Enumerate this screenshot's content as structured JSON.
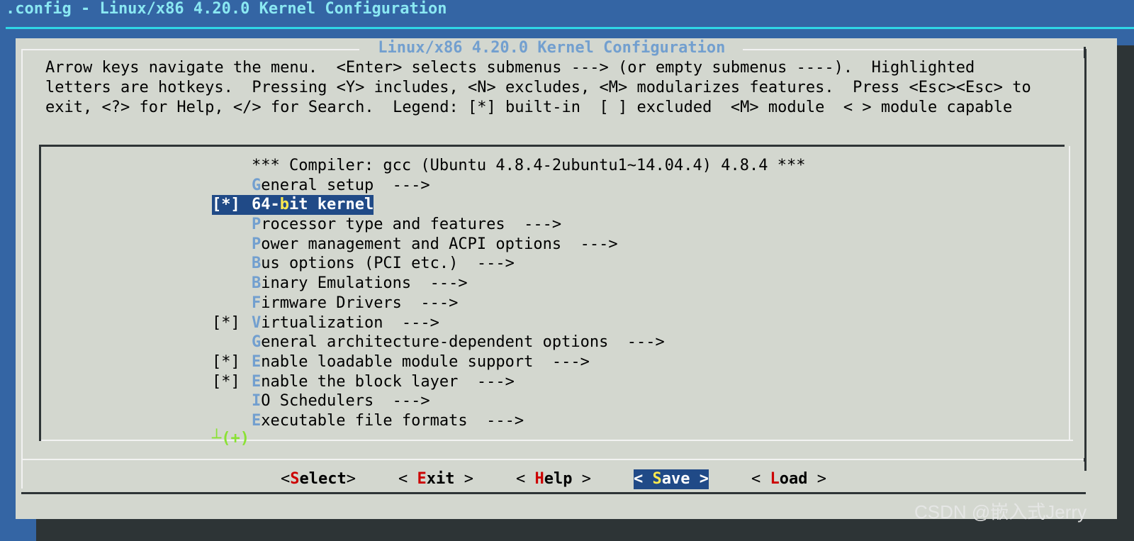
{
  "window": {
    "title": ".config - Linux/x86 4.20.0 Kernel Configuration"
  },
  "dialog": {
    "title": "Linux/x86 4.20.0 Kernel Configuration",
    "help_text": "Arrow keys navigate the menu.  <Enter> selects submenus ---> (or empty submenus ----).  Highlighted\nletters are hotkeys.  Pressing <Y> includes, <N> excludes, <M> modularizes features.  Press <Esc><Esc> to\nexit, <?> for Help, </> for Search.  Legend: [*] built-in  [ ] excluded  <M> module  < > module capable"
  },
  "menu": {
    "items": [
      {
        "prefix": "   ",
        "hot_before": "",
        "hot": "",
        "text": "*** Compiler: gcc (Ubuntu 4.8.4-2ubuntu1~14.04.4) 4.8.4 ***",
        "selected": false
      },
      {
        "prefix": "   ",
        "hot_before": "",
        "hot": "G",
        "text": "eneral setup  --->",
        "selected": false
      },
      {
        "prefix": "[*]",
        "hot_before": "64-",
        "hot": "b",
        "text": "it kernel",
        "selected": true
      },
      {
        "prefix": "   ",
        "hot_before": "",
        "hot": "P",
        "text": "rocessor type and features  --->",
        "selected": false
      },
      {
        "prefix": "   ",
        "hot_before": "",
        "hot": "P",
        "text": "ower management and ACPI options  --->",
        "selected": false
      },
      {
        "prefix": "   ",
        "hot_before": "",
        "hot": "B",
        "text": "us options (PCI etc.)  --->",
        "selected": false
      },
      {
        "prefix": "   ",
        "hot_before": "",
        "hot": "B",
        "text": "inary Emulations  --->",
        "selected": false
      },
      {
        "prefix": "   ",
        "hot_before": "",
        "hot": "F",
        "text": "irmware Drivers  --->",
        "selected": false
      },
      {
        "prefix": "[*]",
        "hot_before": "",
        "hot": "V",
        "text": "irtualization  --->",
        "selected": false
      },
      {
        "prefix": "   ",
        "hot_before": "",
        "hot": "G",
        "text": "eneral architecture-dependent options  --->",
        "selected": false
      },
      {
        "prefix": "[*]",
        "hot_before": "",
        "hot": "E",
        "text": "nable loadable module support  --->",
        "selected": false
      },
      {
        "prefix": "[*]",
        "hot_before": "",
        "hot": "E",
        "text": "nable the block layer  --->",
        "selected": false
      },
      {
        "prefix": "   ",
        "hot_before": "",
        "hot": "I",
        "text": "O Schedulers  --->",
        "selected": false
      },
      {
        "prefix": "   ",
        "hot_before": "",
        "hot": "E",
        "text": "xecutable file formats  --->",
        "selected": false
      }
    ],
    "more_indicator": "┴(+)"
  },
  "buttons": {
    "select": {
      "open": "<",
      "hot": "S",
      "rest": "elect",
      "close": ">"
    },
    "exit": {
      "open": "< ",
      "hot": "E",
      "rest": "xit",
      "close": " >"
    },
    "help": {
      "open": "< ",
      "hot": "H",
      "rest": "elp",
      "close": " >"
    },
    "save": {
      "open": "< ",
      "hot": "S",
      "rest": "ave",
      "close": " >"
    },
    "load": {
      "open": "< ",
      "hot": "L",
      "rest": "oad",
      "close": " >"
    }
  },
  "watermark": "CSDN @嵌入式Jerry",
  "colors": {
    "desktop": "#3465a4",
    "dialog": "#d3d7cf",
    "highlight": "#204a87",
    "hotkey": "#729fcf",
    "button_hotkey": "#cc0000",
    "selected_hotkey": "#fce94f",
    "more_indicator": "#8ae234"
  }
}
